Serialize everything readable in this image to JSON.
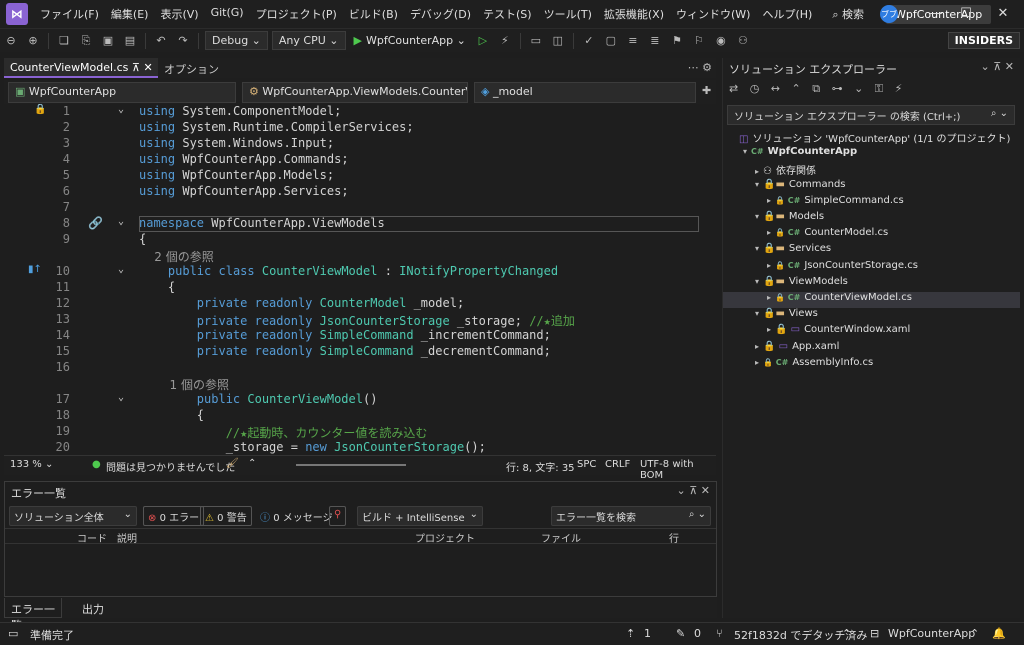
{
  "menu": [
    "ファイル(F)",
    "編集(E)",
    "表示(V)",
    "Git(G)",
    "プロジェクト(P)",
    "ビルド(B)",
    "デバッグ(D)",
    "テスト(S)",
    "ツール(T)",
    "拡張機能(X)",
    "ウィンドウ(W)",
    "ヘルプ(H)"
  ],
  "search_label": "検索",
  "title_badge": "WpfCounterApp",
  "avatar_initials": "ブブ",
  "toolbar": {
    "config": "Debug",
    "platform": "Any CPU",
    "run_label": "WpfCounterApp",
    "insiders": "INSIDERS"
  },
  "doc_tab": {
    "label": "CounterViewModel.cs",
    "option": "オプション"
  },
  "nav": {
    "project": "WpfCounterApp",
    "class": "WpfCounterApp.ViewModels.CounterV",
    "member": "_model"
  },
  "code_lines": [
    {
      "n": "1",
      "text": "using System.ComponentModel;"
    },
    {
      "n": "2",
      "text": "using System.Runtime.CompilerServices;"
    },
    {
      "n": "3",
      "text": "using System.Windows.Input;"
    },
    {
      "n": "4",
      "text": "using WpfCounterApp.Commands;"
    },
    {
      "n": "5",
      "text": "using WpfCounterApp.Models;"
    },
    {
      "n": "6",
      "text": "using WpfCounterApp.Services;"
    },
    {
      "n": "7",
      "text": ""
    },
    {
      "n": "8",
      "text": "namespace WpfCounterApp.ViewModels"
    },
    {
      "n": "9",
      "text": "{"
    },
    {
      "n": "",
      "text": "    2 個の参照"
    },
    {
      "n": "10",
      "text": "    public class CounterViewModel : INotifyPropertyChanged"
    },
    {
      "n": "11",
      "text": "    {"
    },
    {
      "n": "12",
      "text": "        private readonly CounterModel _model;"
    },
    {
      "n": "13",
      "text": "        private readonly JsonCounterStorage _storage; //★追加"
    },
    {
      "n": "14",
      "text": "        private readonly SimpleCommand _incrementCommand;"
    },
    {
      "n": "15",
      "text": "        private readonly SimpleCommand _decrementCommand;"
    },
    {
      "n": "16",
      "text": ""
    },
    {
      "n": "",
      "text": "        1 個の参照"
    },
    {
      "n": "17",
      "text": "        public CounterViewModel()"
    },
    {
      "n": "18",
      "text": "        {"
    },
    {
      "n": "19",
      "text": "            //★起動時、カウンター値を読み込む"
    },
    {
      "n": "20",
      "text": "            _storage = new JsonCounterStorage();"
    }
  ],
  "editor_status": {
    "zoom": "133 %",
    "issues": "問題は見つかりませんでした",
    "position": "行: 8, 文字: 35",
    "spc": "SPC",
    "crlf": "CRLF",
    "encoding": "UTF-8 with BOM"
  },
  "error_list": {
    "title": "エラー一覧",
    "scope": "ソリューション全体",
    "errors": "0 エラー",
    "warnings": "0 警告",
    "messages": "0 メッセージ",
    "build": "ビルド + IntelliSense",
    "search_placeholder": "エラー一覧を検索",
    "columns": [
      "コード",
      "説明",
      "プロジェクト",
      "ファイル",
      "行"
    ]
  },
  "bottom_tabs": [
    "エラー一覧",
    "出力"
  ],
  "status": {
    "ready": "準備完了",
    "up": "1",
    "edits": "0",
    "branch": "52f1832d でデタッチ済み",
    "project": "WpfCounterApp"
  },
  "solution_explorer": {
    "title": "ソリューション エクスプローラー",
    "search": "ソリューション エクスプローラー の検索 (Ctrl+;)",
    "tree": [
      {
        "label": "ソリューション 'WpfCounterApp' (1/1 のプロジェクト)",
        "indent": 0,
        "icon": "solution",
        "twisty": ""
      },
      {
        "label": "WpfCounterApp",
        "indent": 1,
        "icon": "project",
        "twisty": "▾"
      },
      {
        "label": "依存関係",
        "indent": 2,
        "icon": "deps",
        "twisty": "▸"
      },
      {
        "label": "Commands",
        "indent": 2,
        "icon": "folder",
        "twisty": "▾"
      },
      {
        "label": "SimpleCommand.cs",
        "indent": 3,
        "icon": "cs",
        "twisty": "▸"
      },
      {
        "label": "Models",
        "indent": 2,
        "icon": "folder",
        "twisty": "▾"
      },
      {
        "label": "CounterModel.cs",
        "indent": 3,
        "icon": "cs",
        "twisty": "▸"
      },
      {
        "label": "Services",
        "indent": 2,
        "icon": "folder",
        "twisty": "▾"
      },
      {
        "label": "JsonCounterStorage.cs",
        "indent": 3,
        "icon": "cs",
        "twisty": "▸"
      },
      {
        "label": "ViewModels",
        "indent": 2,
        "icon": "folder",
        "twisty": "▾"
      },
      {
        "label": "CounterViewModel.cs",
        "indent": 3,
        "icon": "cs",
        "twisty": "▸",
        "selected": true
      },
      {
        "label": "Views",
        "indent": 2,
        "icon": "folder",
        "twisty": "▾"
      },
      {
        "label": "CounterWindow.xaml",
        "indent": 3,
        "icon": "xaml",
        "twisty": "▸"
      },
      {
        "label": "App.xaml",
        "indent": 2,
        "icon": "xaml",
        "twisty": "▸"
      },
      {
        "label": "AssemblyInfo.cs",
        "indent": 2,
        "icon": "cs",
        "twisty": "▸"
      }
    ]
  }
}
